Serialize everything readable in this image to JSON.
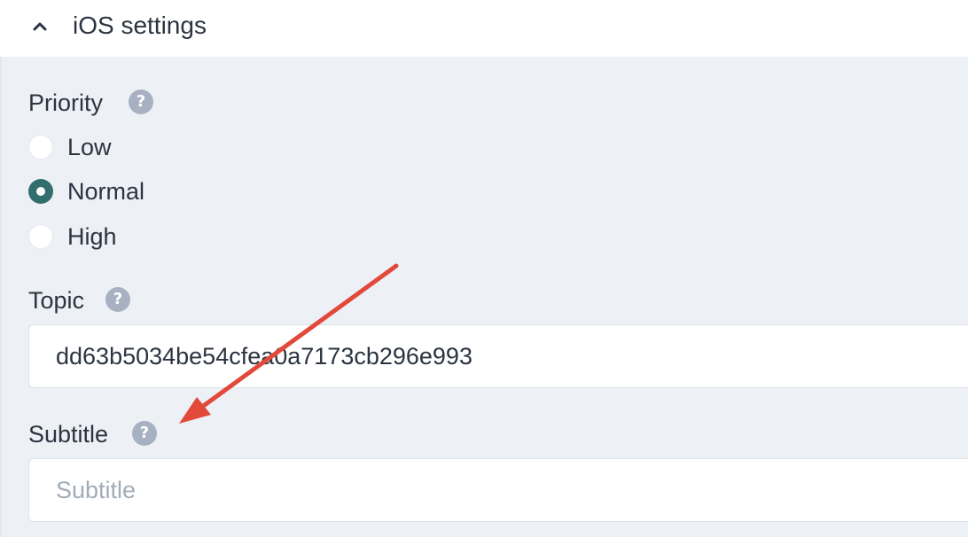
{
  "section": {
    "title": "iOS settings",
    "expanded": true,
    "toggle_icon": "chevron-up-icon"
  },
  "priority": {
    "label": "Priority",
    "help_glyph": "?",
    "options": [
      {
        "label": "Low",
        "checked": false
      },
      {
        "label": "Normal",
        "checked": true
      },
      {
        "label": "High",
        "checked": false
      }
    ]
  },
  "topic": {
    "label": "Topic",
    "help_glyph": "?",
    "value": "dd63b5034be54cfea0a7173cb296e993",
    "placeholder": ""
  },
  "subtitle": {
    "label": "Subtitle",
    "help_glyph": "?",
    "value": "",
    "placeholder": "Subtitle"
  },
  "colors": {
    "panel_bg": "#edf0f5",
    "radio_checked": "#336e6e",
    "help_icon": "#a7b1c2",
    "annotation_arrow": "#e2493a"
  },
  "annotation": {
    "type": "arrow",
    "points_to": "subtitle-label"
  }
}
